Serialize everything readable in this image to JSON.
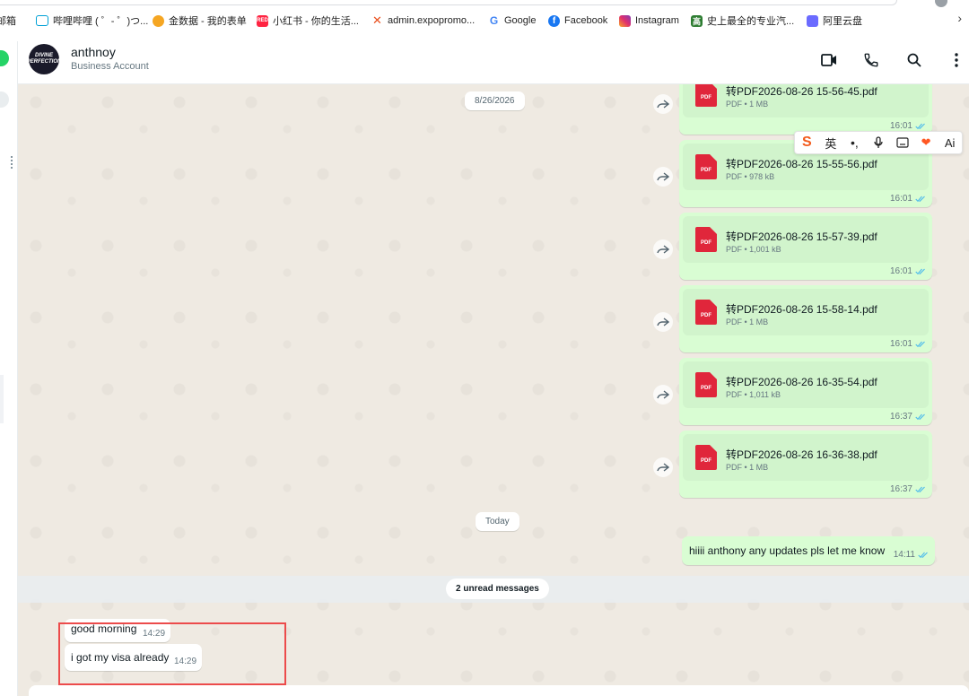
{
  "bookmarks": [
    {
      "label": "邮箱",
      "icon": "mail-icon"
    },
    {
      "label": "哔哩哔哩 ( ゜- ゜)つ...",
      "icon": "bilibili-icon"
    },
    {
      "label": "金数据 - 我的表单",
      "icon": "jinshuju-icon"
    },
    {
      "label": "小红书 - 你的生活...",
      "icon": "xiaohongshu-icon"
    },
    {
      "label": "admin.expopromo...",
      "icon": "expopromo-icon"
    },
    {
      "label": "Google",
      "icon": "google-icon"
    },
    {
      "label": "Facebook",
      "icon": "facebook-icon"
    },
    {
      "label": "Instagram",
      "icon": "instagram-icon"
    },
    {
      "label": "史上最全的专业汽...",
      "icon": "car-site-icon"
    },
    {
      "label": "阿里云盘",
      "icon": "aliyun-drive-icon"
    }
  ],
  "header": {
    "contact_name": "anthnoy",
    "contact_subtitle": "Business Account",
    "avatar_text": "DIVINE PERFECTION"
  },
  "ime_toolbar": {
    "lang": "英",
    "ai": "Ai"
  },
  "chat": {
    "date_separator": "8/26/2026",
    "today_separator": "Today",
    "files": [
      {
        "name": "转PDF2026-08-26 15-56-45.pdf",
        "meta": "PDF • 1 MB",
        "time": "16:01"
      },
      {
        "name": "转PDF2026-08-26 15-55-56.pdf",
        "meta": "PDF • 978 kB",
        "time": "16:01"
      },
      {
        "name": "转PDF2026-08-26 15-57-39.pdf",
        "meta": "PDF • 1,001 kB",
        "time": "16:01"
      },
      {
        "name": "转PDF2026-08-26 15-58-14.pdf",
        "meta": "PDF • 1 MB",
        "time": "16:01"
      },
      {
        "name": "转PDF2026-08-26 16-35-54.pdf",
        "meta": "PDF • 1,011 kB",
        "time": "16:37"
      },
      {
        "name": "转PDF2026-08-26 16-36-38.pdf",
        "meta": "PDF • 1 MB",
        "time": "16:37"
      }
    ],
    "outgoing_text": {
      "text": "hiiii anthony any updates pls let me know",
      "time": "14:11"
    },
    "unread_banner": "2 unread messages",
    "incoming": [
      {
        "text": "good morning",
        "time": "14:29"
      },
      {
        "text": "i got my visa already",
        "time": "14:29"
      }
    ]
  },
  "colors": {
    "outgoing_bubble": "#d9fdd3",
    "chat_bg": "#efeae2",
    "highlight": "#ec4b4b",
    "tick": "#53bdeb"
  }
}
